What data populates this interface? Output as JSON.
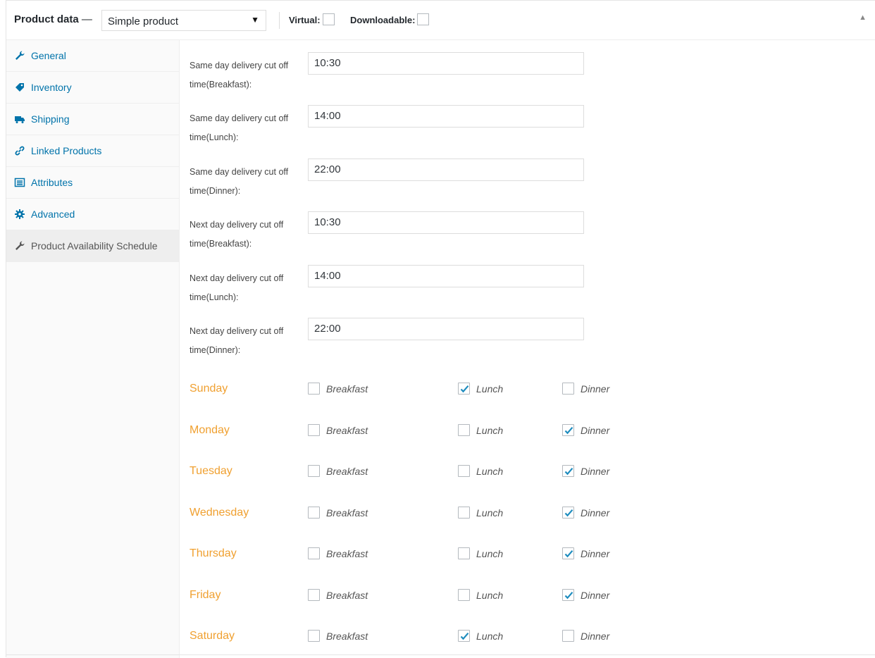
{
  "header": {
    "title": "Product data",
    "dash": "—",
    "product_type": "Simple product",
    "virtual_label": "Virtual:",
    "downloadable_label": "Downloadable:",
    "collapse_glyph": "▲",
    "select_arrow": "▼"
  },
  "sidebar": {
    "tabs": [
      {
        "label": "General",
        "icon": "wrench-icon"
      },
      {
        "label": "Inventory",
        "icon": "tag-icon"
      },
      {
        "label": "Shipping",
        "icon": "truck-icon"
      },
      {
        "label": "Linked Products",
        "icon": "link-icon"
      },
      {
        "label": "Attributes",
        "icon": "list-icon"
      },
      {
        "label": "Advanced",
        "icon": "gear-icon"
      },
      {
        "label": "Product Availability Schedule",
        "icon": "wrench-icon"
      }
    ]
  },
  "cutoffs": [
    {
      "label": "Same day delivery cut off time(Breakfast):",
      "value": "10:30"
    },
    {
      "label": "Same day delivery cut off time(Lunch):",
      "value": "14:00"
    },
    {
      "label": "Same day delivery cut off time(Dinner):",
      "value": "22:00"
    },
    {
      "label": "Next day delivery cut off time(Breakfast):",
      "value": "10:30"
    },
    {
      "label": "Next day delivery cut off time(Lunch):",
      "value": "14:00"
    },
    {
      "label": "Next day delivery cut off time(Dinner):",
      "value": "22:00"
    }
  ],
  "meal_labels": {
    "breakfast": "Breakfast",
    "lunch": "Lunch",
    "dinner": "Dinner"
  },
  "schedule": [
    {
      "day": "Sunday",
      "breakfast": false,
      "lunch": true,
      "dinner": false
    },
    {
      "day": "Monday",
      "breakfast": false,
      "lunch": false,
      "dinner": true
    },
    {
      "day": "Tuesday",
      "breakfast": false,
      "lunch": false,
      "dinner": true
    },
    {
      "day": "Wednesday",
      "breakfast": false,
      "lunch": false,
      "dinner": true
    },
    {
      "day": "Thursday",
      "breakfast": false,
      "lunch": false,
      "dinner": true
    },
    {
      "day": "Friday",
      "breakfast": false,
      "lunch": false,
      "dinner": true
    },
    {
      "day": "Saturday",
      "breakfast": false,
      "lunch": true,
      "dinner": false
    }
  ],
  "colors": {
    "link": "#0073aa",
    "day": "#f0a030",
    "check": "#1e8cbe"
  }
}
